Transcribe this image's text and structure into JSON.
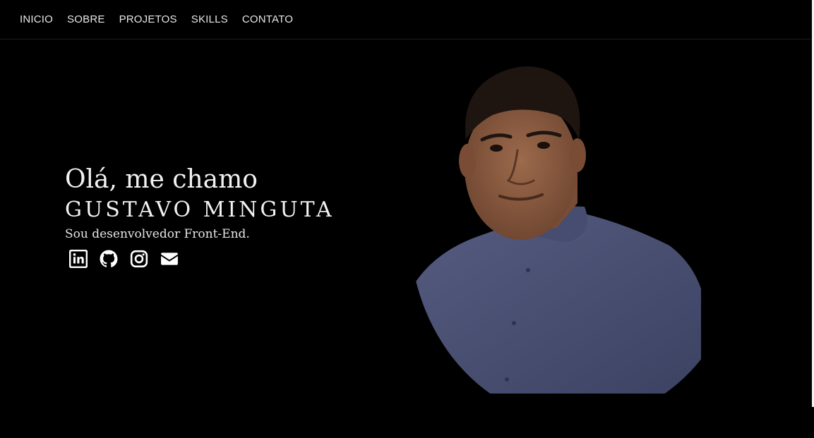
{
  "nav": {
    "items": [
      {
        "label": "INICIO"
      },
      {
        "label": "SOBRE"
      },
      {
        "label": "PROJETOS"
      },
      {
        "label": "SKILLS"
      },
      {
        "label": "CONTATO"
      }
    ]
  },
  "hero": {
    "greeting": "Olá, me chamo",
    "name": "GUSTAVO MINGUTA",
    "subtitle": "Sou desenvolvedor Front-End."
  },
  "socials": [
    {
      "icon": "linkedin-icon"
    },
    {
      "icon": "github-icon"
    },
    {
      "icon": "instagram-icon"
    },
    {
      "icon": "envelope-icon"
    }
  ],
  "colors": {
    "background": "#000000",
    "text": "#f2f2f2",
    "shirt": "#4a5070",
    "skin": "#8a5a40",
    "hair": "#1e1510"
  }
}
